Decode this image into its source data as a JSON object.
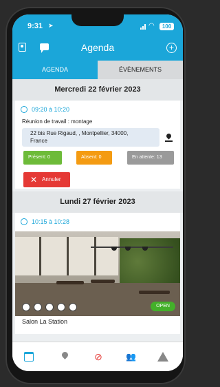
{
  "status_bar": {
    "time": "9:31",
    "battery": "100"
  },
  "header": {
    "title": "Agenda"
  },
  "tabs": [
    {
      "label": "AGENDA"
    },
    {
      "label": "ÉVÈNEMENTS"
    }
  ],
  "events": [
    {
      "date": "Mercredi 22 février 2023",
      "time": "09:20 à 10:20",
      "description": "Réunion de travail : montage",
      "address_line1": "22 bis Rue Rigaud, , Montpellier, 34000,",
      "address_line2": "France",
      "present": "Présent: 0",
      "absent": "Absent: 0",
      "pending": "En attente: 13",
      "cancel": "Annuler"
    },
    {
      "date": "Lundi 27 février 2023",
      "time": "10:15 à 10:28",
      "status": "OPEN",
      "venue": "Salon La Station"
    }
  ],
  "colors": {
    "primary": "#1ba6d9",
    "present": "#6dbb39",
    "absent": "#f49b12",
    "pending": "#9a9a9a",
    "cancel": "#e53935",
    "open": "#43b02a"
  },
  "bottom_nav": [
    "calendar-icon",
    "map-pin-icon",
    "eye-off-icon",
    "users-icon",
    "warning-icon"
  ]
}
